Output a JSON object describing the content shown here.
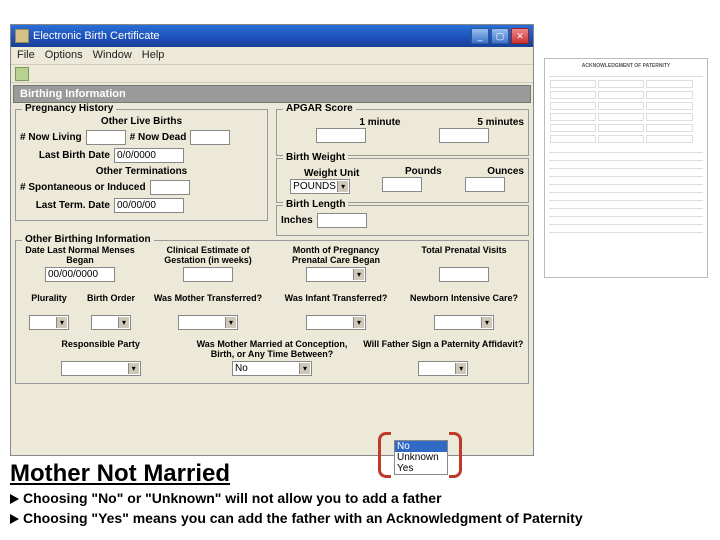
{
  "window": {
    "title": "Electronic Birth Certificate",
    "menus": [
      "File",
      "Options",
      "Window",
      "Help"
    ],
    "section_title": "Birthing Information"
  },
  "pregnancy": {
    "legend": "Pregnancy History",
    "other_live_births": "Other Live Births",
    "now_living": "# Now Living",
    "now_dead": "# Now Dead",
    "last_birth_date": "Last Birth Date",
    "last_birth_date_val": "0/0/0000",
    "other_terminations": "Other Terminations",
    "spontaneous": "# Spontaneous or Induced",
    "last_term_date": "Last Term. Date",
    "last_term_date_val": "00/00/00"
  },
  "apgar": {
    "legend": "APGAR Score",
    "one_min": "1 minute",
    "five_min": "5 minutes"
  },
  "weight": {
    "legend": "Birth Weight",
    "unit": "Weight Unit",
    "unit_val": "POUNDS",
    "pounds": "Pounds",
    "ounces": "Ounces"
  },
  "length": {
    "legend": "Birth Length",
    "inches": "Inches"
  },
  "other": {
    "legend": "Other Birthing Information",
    "menses": "Date Last Normal Menses Began",
    "menses_val": "00/00/0000",
    "gestation": "Clinical Estimate of Gestation (in weeks)",
    "prenatal_month": "Month of Pregnancy Prenatal Care Began",
    "visits": "Total Prenatal Visits",
    "plurality": "Plurality",
    "birth_order": "Birth Order",
    "mother_transferred": "Was Mother Transferred?",
    "infant_transferred": "Was Infant Transferred?",
    "nicu": "Newborn Intensive Care?",
    "responsible": "Responsible Party",
    "married_q": "Was Mother Married at Conception, Birth, or Any Time Between?",
    "married_val": "No",
    "paternity_q": "Will Father Sign a Paternity Affidavit?"
  },
  "dropdown": {
    "options": [
      "No",
      "Unknown",
      "Yes"
    ]
  },
  "annotation": {
    "heading": "Mother Not Married",
    "bullet1": "Choosing \"No\" or \"Unknown\" will not allow you to add a father",
    "bullet2": "Choosing \"Yes\" means you can add the father with an Acknowledgment of Paternity"
  },
  "thumb": {
    "title": "ACKNOWLEDGMENT OF PATERNITY"
  }
}
